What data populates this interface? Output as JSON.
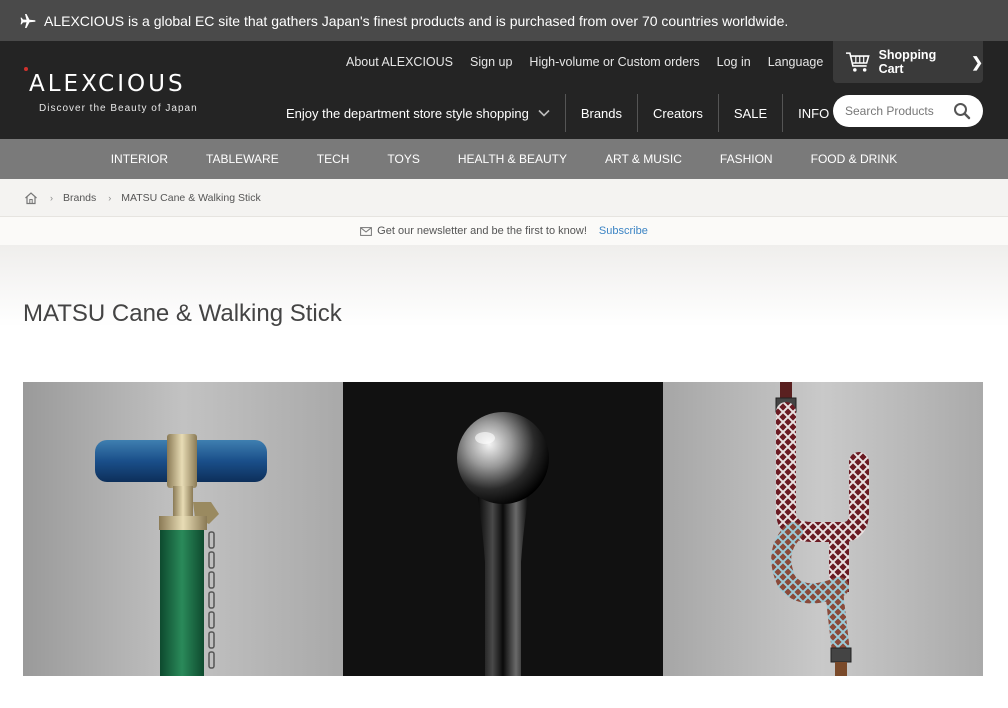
{
  "announcement": {
    "text": "ALEXCIOUS is a global EC site that gathers Japan's finest products and is purchased from over 70 countries worldwide."
  },
  "logo": {
    "name": "ALEXCIOUS",
    "tagline": "Discover the Beauty of Japan"
  },
  "topnav": [
    "About ALEXCIOUS",
    "Sign up",
    "High-volume or Custom orders",
    "Log in",
    "Language"
  ],
  "cart": {
    "label": "Shopping Cart"
  },
  "mainnav": {
    "dept": "Enjoy the department store style shopping",
    "items": [
      "Brands",
      "Creators",
      "SALE",
      "INFO"
    ]
  },
  "search": {
    "placeholder": "Search Products"
  },
  "categories": [
    "INTERIOR",
    "TABLEWARE",
    "TECH",
    "TOYS",
    "HEALTH & BEAUTY",
    "ART & MUSIC",
    "FASHION",
    "FOOD & DRINK"
  ],
  "breadcrumb": [
    "Brands",
    "MATSU Cane & Walking Stick"
  ],
  "newsletter": {
    "text": "Get our newsletter and be the first to know!",
    "link": "Subscribe"
  },
  "page": {
    "title": "MATSU Cane & Walking Stick"
  },
  "colors": {
    "header_bg": "#242424",
    "announce_bg": "#4a4a4a",
    "category_bg": "#7a7a7a",
    "link": "#3c84c4",
    "logo_dot": "#d0312d"
  }
}
